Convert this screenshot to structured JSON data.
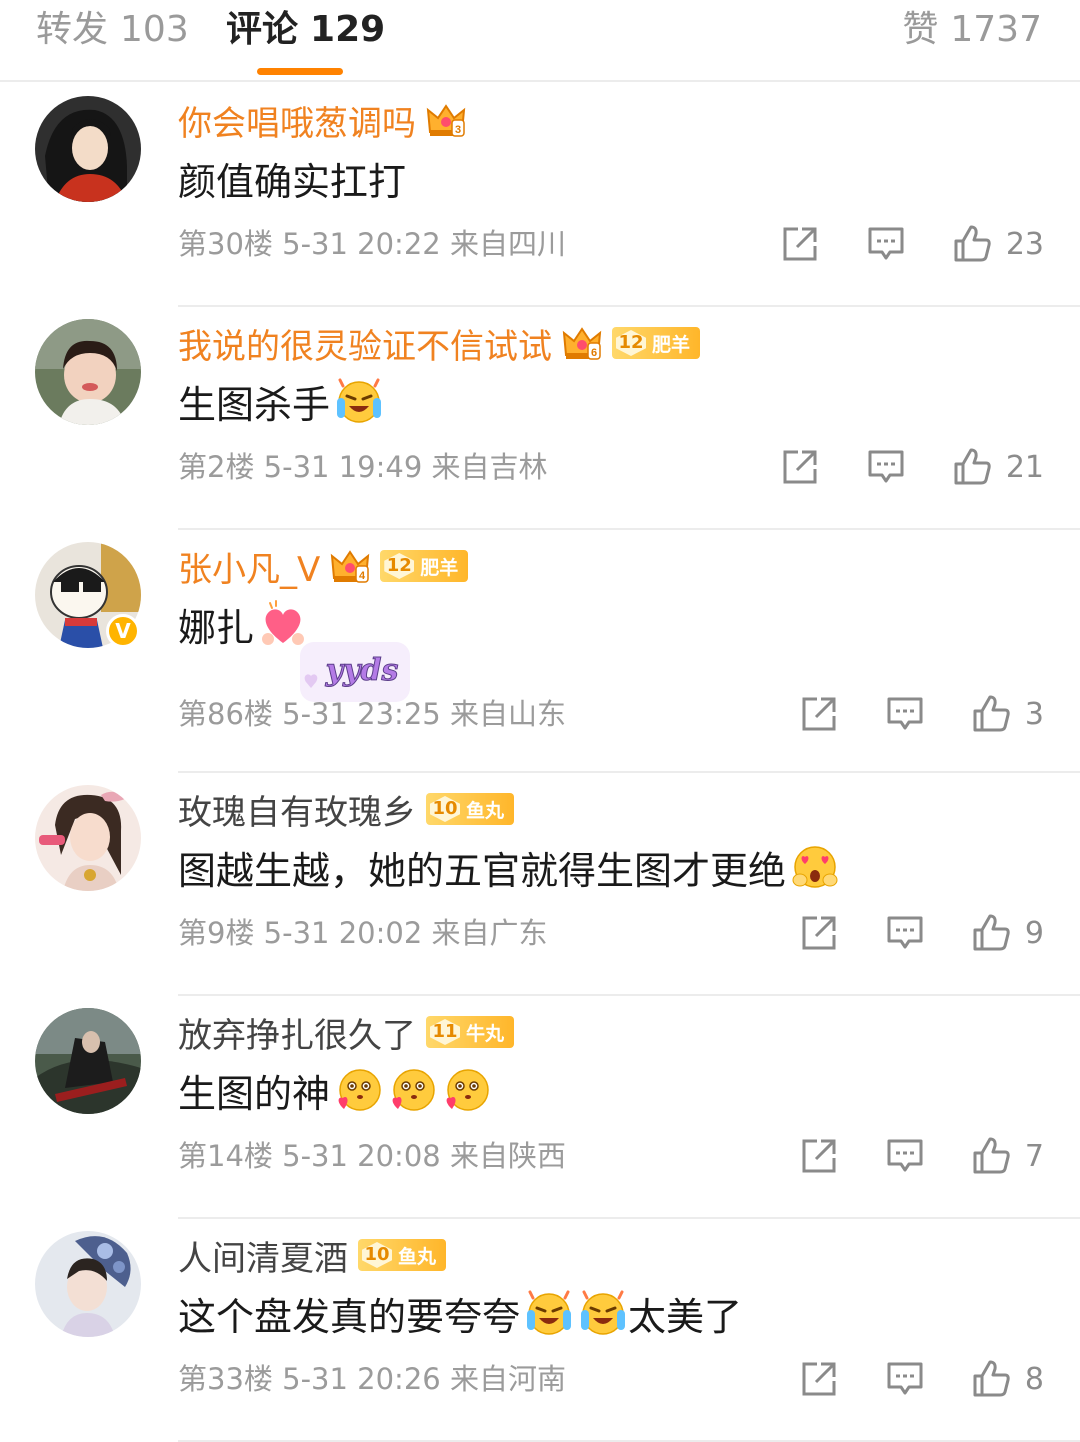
{
  "tabs": {
    "repost": {
      "label": "转发",
      "count": "103"
    },
    "comment": {
      "label": "评论",
      "count": "129"
    },
    "like": {
      "label": "赞",
      "count": "1737"
    }
  },
  "colors": {
    "accent": "#ff8200",
    "vip_name": "#f08220",
    "badge": "#ffb62a"
  },
  "comments": [
    {
      "username": "你会唱哦葱调吗",
      "text": "颜值确实扛打",
      "floor": "第30楼",
      "date": "5-31 20:22",
      "location": "来自四川",
      "likes": "23",
      "emojis": []
    },
    {
      "username": "我说的很灵验证不信试试",
      "text": "生图杀手",
      "badge_level": "12",
      "badge_text": "肥羊",
      "floor": "第2楼",
      "date": "5-31 19:49",
      "location": "来自吉林",
      "likes": "21",
      "emojis": [
        "excited-tears-emoji"
      ]
    },
    {
      "username": "张小凡_V",
      "text": "娜扎",
      "badge_level": "12",
      "badge_text": "肥羊",
      "verified": "V",
      "sticker": "yyds",
      "floor": "第86楼",
      "date": "5-31 23:25",
      "location": "来自山东",
      "likes": "3",
      "emojis": [
        "heart-emoji"
      ]
    },
    {
      "username": "玫瑰自有玫瑰乡",
      "text": "图越生越，她的五官就得生图才更绝",
      "badge_level": "10",
      "badge_text": "鱼丸",
      "floor": "第9楼",
      "date": "5-31 20:02",
      "location": "来自广东",
      "likes": "9",
      "emojis": [
        "heart-eyes-emoji"
      ]
    },
    {
      "username": "放弃挣扎很久了",
      "text": "生图的神",
      "badge_level": "11",
      "badge_text": "牛丸",
      "floor": "第14楼",
      "date": "5-31 20:08",
      "location": "来自陕西",
      "likes": "7",
      "emojis": [
        "adoring-emoji",
        "adoring-emoji",
        "adoring-emoji"
      ]
    },
    {
      "username": "人间清夏酒",
      "text": "这个盘发真的要夸夸",
      "text_after": "太美了",
      "badge_level": "10",
      "badge_text": "鱼丸",
      "floor": "第33楼",
      "date": "5-31 20:26",
      "location": "来自河南",
      "likes": "8",
      "emojis": [
        "excited-tears-emoji",
        "excited-tears-emoji"
      ]
    }
  ]
}
